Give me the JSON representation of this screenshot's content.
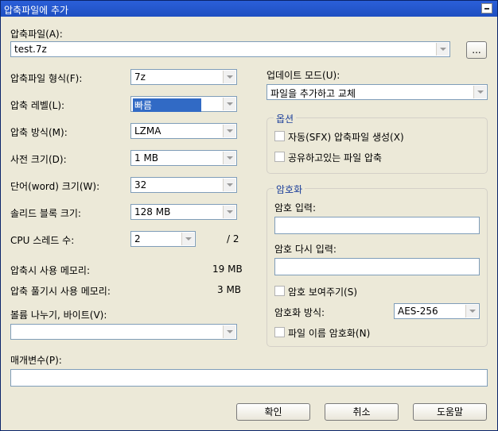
{
  "window": {
    "title": "압축파일에 추가"
  },
  "archive": {
    "label": "압축파일(A):",
    "value": "test.7z",
    "browse_label": "..."
  },
  "left": {
    "format": {
      "label": "압축파일 형식(F):",
      "value": "7z"
    },
    "level": {
      "label": "압축 레벨(L):",
      "value": "빠름"
    },
    "method": {
      "label": "압축 방식(M):",
      "value": "LZMA"
    },
    "dict": {
      "label": "사전 크기(D):",
      "value": "1 MB"
    },
    "word": {
      "label": "단어(word) 크기(W):",
      "value": "32"
    },
    "solid": {
      "label": "솔리드 블록 크기:",
      "value": "128 MB"
    },
    "cpu": {
      "label": "CPU 스레드 수:",
      "value": "2",
      "max": "/ 2"
    },
    "mem_compress": {
      "label": "압축시 사용 메모리:",
      "value": "19 MB"
    },
    "mem_decompress": {
      "label": "압축 풀기시 사용 메모리:",
      "value": "3 MB"
    },
    "volume": {
      "label": "볼륨 나누기, 바이트(V):",
      "value": ""
    }
  },
  "params": {
    "label": "매개변수(P):",
    "value": ""
  },
  "right": {
    "update": {
      "label": "업데이트 모드(U):",
      "value": "파일을 추가하고 교체"
    },
    "options": {
      "caption": "옵션",
      "sfx_label": "자동(SFX) 압축파일 생성(X)",
      "shared_label": "공유하고있는 파일 압축"
    },
    "encryption": {
      "caption": "암호화",
      "password_label": "암호 입력:",
      "reenter_label": "암호 다시 입력:",
      "show_label": "암호 보여주기(S)",
      "method_label": "암호화 방식:",
      "method_value": "AES-256",
      "encrypt_names_label": "파일 이름 암호화(N)"
    }
  },
  "buttons": {
    "ok": "확인",
    "cancel": "취소",
    "help": "도움말"
  }
}
